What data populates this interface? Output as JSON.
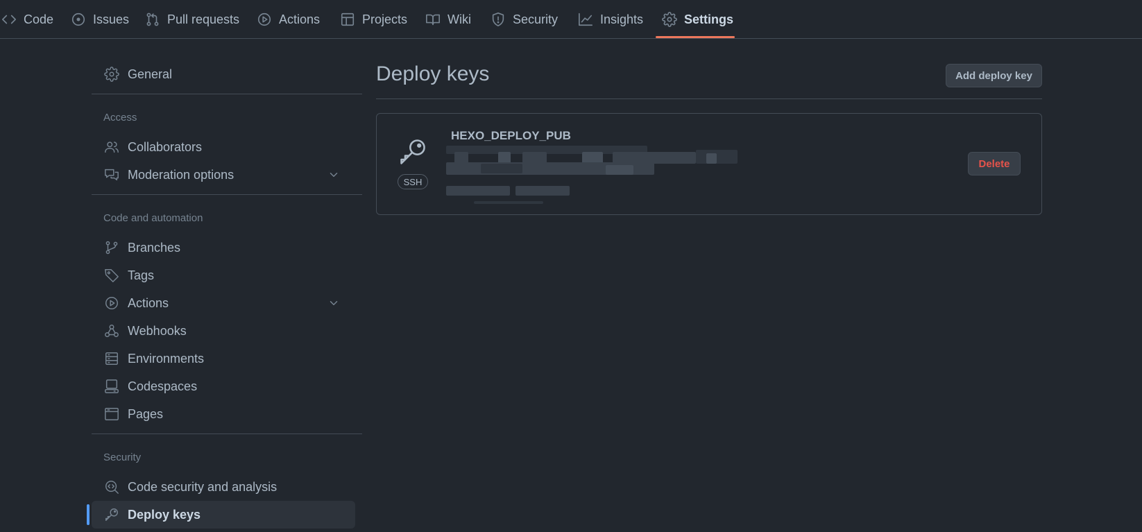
{
  "tabs": [
    {
      "label": "Code",
      "icon": "code-icon"
    },
    {
      "label": "Issues",
      "icon": "issue-opened-icon"
    },
    {
      "label": "Pull requests",
      "icon": "git-pull-request-icon"
    },
    {
      "label": "Actions",
      "icon": "play-icon"
    },
    {
      "label": "Projects",
      "icon": "table-icon"
    },
    {
      "label": "Wiki",
      "icon": "book-icon"
    },
    {
      "label": "Security",
      "icon": "shield-icon"
    },
    {
      "label": "Insights",
      "icon": "graph-icon"
    },
    {
      "label": "Settings",
      "icon": "gear-icon",
      "active": true
    }
  ],
  "sidebar": {
    "general": {
      "label": "General",
      "icon": "gear-icon"
    },
    "access_heading": "Access",
    "access_items": [
      {
        "label": "Collaborators",
        "icon": "people-icon"
      },
      {
        "label": "Moderation options",
        "icon": "comment-discussion-icon",
        "expandable": true
      }
    ],
    "code_heading": "Code and automation",
    "code_items": [
      {
        "label": "Branches",
        "icon": "git-branch-icon"
      },
      {
        "label": "Tags",
        "icon": "tag-icon"
      },
      {
        "label": "Actions",
        "icon": "play-icon",
        "expandable": true
      },
      {
        "label": "Webhooks",
        "icon": "webhook-icon"
      },
      {
        "label": "Environments",
        "icon": "server-icon"
      },
      {
        "label": "Codespaces",
        "icon": "codespaces-icon"
      },
      {
        "label": "Pages",
        "icon": "browser-icon"
      }
    ],
    "security_heading": "Security",
    "security_items": [
      {
        "label": "Code security and analysis",
        "icon": "codescan-icon"
      },
      {
        "label": "Deploy keys",
        "icon": "key-icon",
        "active": true
      }
    ]
  },
  "main": {
    "title": "Deploy keys",
    "add_button_label": "Add deploy key",
    "keys": [
      {
        "name": "HEXO_DEPLOY_PUB",
        "type_badge": "SSH",
        "delete_label": "Delete"
      }
    ]
  },
  "colors": {
    "background": "#22272e",
    "border": "#444c56",
    "text": "#adbac7",
    "accent_tab": "#ec775c",
    "accent_active": "#539bf5",
    "danger": "#e5534b"
  }
}
